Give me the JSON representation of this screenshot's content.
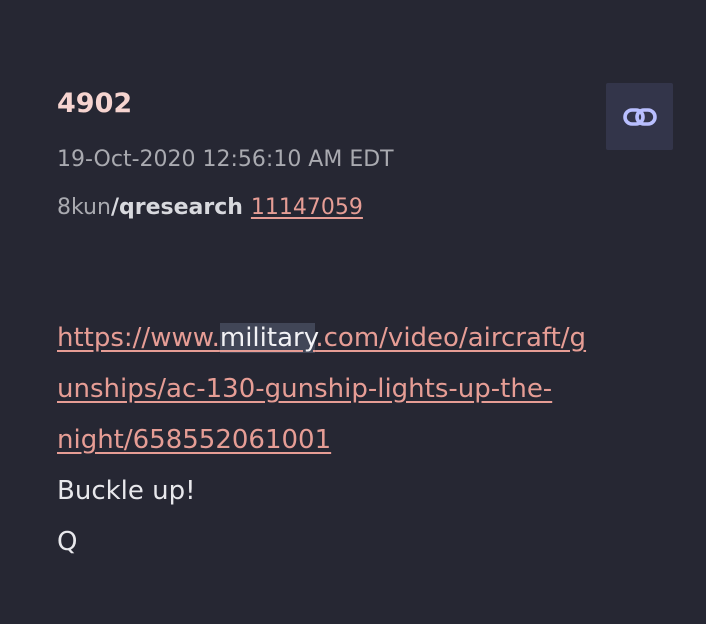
{
  "post": {
    "number": "4902",
    "timestamp": "19-Oct-2020 12:56:10 AM EDT",
    "site": "8kun",
    "board": "/qresearch",
    "reference_post_id": "11147059",
    "link_button_icon": "chain-link-icon",
    "url_lines": [
      "https://www.",
      "military",
      ".com/video/aircraft/g",
      "unships/ac-130-gunship-lights-up-the-",
      "night/658552061001"
    ],
    "body_lines": [
      "Buckle up!",
      "Q"
    ]
  },
  "colors": {
    "background": "#262733",
    "post_number": "#f6d4d0",
    "muted_text": "#a9aab0",
    "link": "#e69d95",
    "body_text": "#e8e8ec",
    "link_button_bg": "#33354a",
    "link_icon": "#b9bfff",
    "highlight": "#414657"
  }
}
